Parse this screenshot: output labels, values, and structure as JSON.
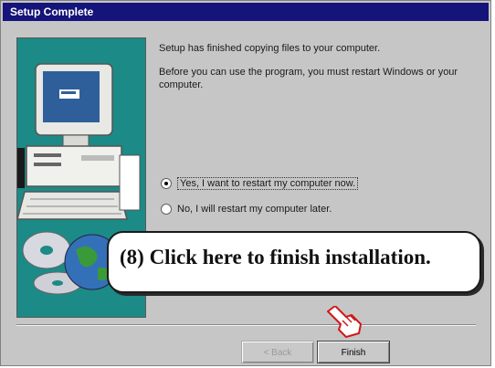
{
  "window": {
    "title": "Setup Complete"
  },
  "message": {
    "line1": "Setup has finished copying files to your computer.",
    "line2": "Before you can use the program, you must restart Windows or your computer."
  },
  "options": [
    {
      "label": "Yes, I want to restart my computer now.",
      "selected": true
    },
    {
      "label": "No, I will restart my computer later.",
      "selected": false
    }
  ],
  "buttons": {
    "back": "< Back",
    "finish": "Finish"
  },
  "callout": {
    "text": "(8)  Click here to finish installation."
  },
  "icons": [
    "computer-icon",
    "cd-disc-icon",
    "globe-icon",
    "hand-pointer-icon"
  ],
  "colors": {
    "titlebar": "#14147a",
    "art_background": "#1c8a86",
    "dialog": "#c6c6c6"
  }
}
